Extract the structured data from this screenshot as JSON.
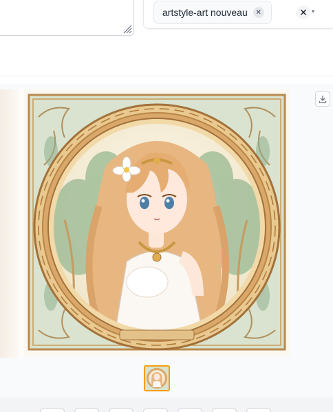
{
  "prompt": {
    "value": ""
  },
  "style_selector": {
    "selected_chip": "artstyle-art nouveau",
    "chip_remove_icon": "close-icon",
    "clear_icon": "close-icon",
    "dropdown_icon": "chevron-down-icon"
  },
  "gallery": {
    "image_subject": "Art nouveau anime girl",
    "download_icon": "download-icon",
    "thumbnail_count": 1,
    "selected_index": 0,
    "accent": "#f59e0b"
  },
  "symbols": {
    "chip_x": "✕",
    "clear_x": "✕",
    "caret": "▾"
  }
}
